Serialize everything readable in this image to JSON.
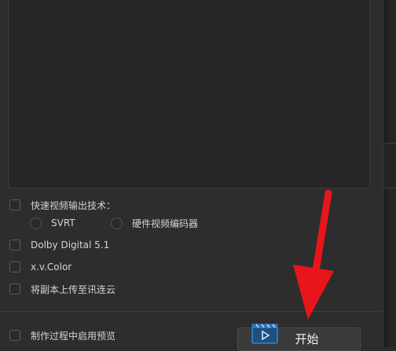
{
  "options": {
    "fast_video_label": "快速视频输出技术：",
    "svrt_label": "SVRT",
    "hw_encoder_label": "硬件视频编码器",
    "dolby_label": "Dolby Digital 5.1",
    "xvcolor_label": "x.v.Color",
    "upload_label": "将副本上传至讯连云"
  },
  "footer": {
    "preview_label": "制作过程中启用预览",
    "start_label": "开始"
  },
  "colors": {
    "annotation_arrow": "#e8151b",
    "button_icon": "#2f86d9"
  }
}
